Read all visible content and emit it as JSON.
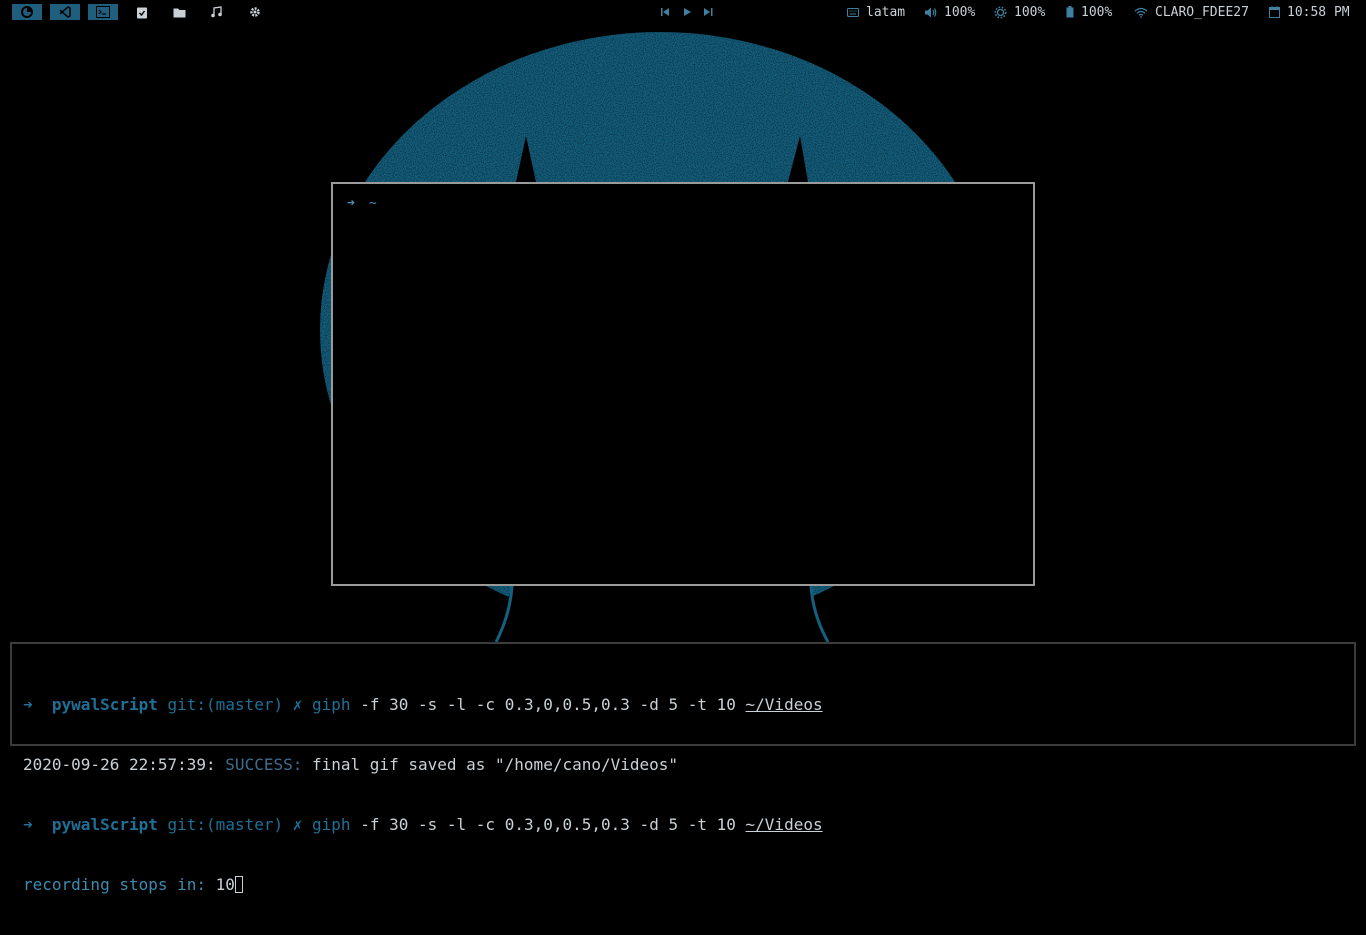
{
  "topbar": {
    "workspaces": [
      {
        "icon": "firefox-icon",
        "active": true
      },
      {
        "icon": "vscode-icon",
        "active": true
      },
      {
        "icon": "terminal-icon",
        "active": true
      },
      {
        "icon": "tasks-icon",
        "active": false
      },
      {
        "icon": "folder-icon",
        "active": false
      },
      {
        "icon": "music-icon",
        "active": false
      },
      {
        "icon": "settings-icon",
        "active": false
      }
    ],
    "media": [
      "previous-icon",
      "play-icon",
      "next-icon"
    ],
    "keyboard_layout": "latam",
    "volume": "100%",
    "brightness": "100%",
    "battery": "100%",
    "wifi": "CLARO_FDEE27",
    "clock": "10:58 PM"
  },
  "floating_terminal": {
    "prompt_arrow": "➜",
    "prompt_dir": "~"
  },
  "bottom_terminal": {
    "line1": {
      "arrow": "➜",
      "dir": "pywalScript",
      "git": "git:(master)",
      "cross": "✗",
      "cmd": "giph",
      "args": "-f 30 -s -l -c 0.3,0,0.5,0.3 -d 5 -t 10",
      "path": "~/Videos"
    },
    "line2": {
      "timestamp": "2020-09-26 22:57:39:",
      "status": "SUCCESS:",
      "message": "final gif saved as \"/home/cano/Videos\""
    },
    "line3": {
      "arrow": "➜",
      "dir": "pywalScript",
      "git": "git:(master)",
      "cross": "✗",
      "cmd": "giph",
      "args": "-f 30 -s -l -c 0.3,0,0.5,0.3 -d 5 -t 10",
      "path": "~/Videos"
    },
    "line4": {
      "label": "recording stops in:",
      "value": "10"
    }
  },
  "colors": {
    "accent": "#1f6f97",
    "wallpaper_blue": "#14607f",
    "text": "#c9d1d6"
  }
}
